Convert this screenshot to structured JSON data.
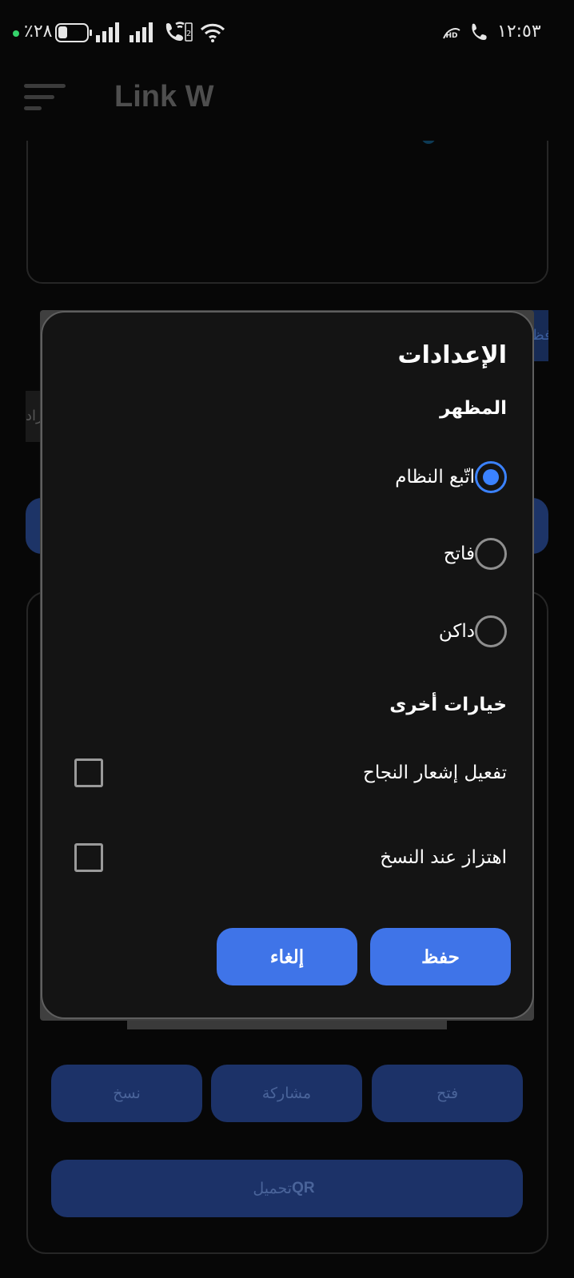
{
  "status_bar": {
    "battery_percent": "٪٢٨",
    "time": "١٢:٥٣",
    "icons": [
      "battery-icon",
      "signal-icon",
      "signal-icon",
      "wifi-calling-icon",
      "wifi-icon",
      "hd-voice-icon",
      "phone-icon"
    ]
  },
  "app_bar": {
    "title": "Link W",
    "menu_icon": "menu-icon"
  },
  "background": {
    "right_tab_fragment": "فظ",
    "left_tab_fragment": "راد",
    "buttons": {
      "open": "فتح",
      "share": "مشاركة",
      "copy": "نسخ",
      "download_qr_text": "تحميل",
      "download_qr_bold": "QR"
    }
  },
  "dialog": {
    "title": "الإعدادات",
    "appearance": {
      "heading": "المظهر",
      "options": [
        {
          "label": "اتّبع النظام",
          "checked": true
        },
        {
          "label": "فاتح",
          "checked": false
        },
        {
          "label": "داكن",
          "checked": false
        }
      ]
    },
    "other": {
      "heading": "خيارات أخرى",
      "options": [
        {
          "label": "تفعيل إشعار النجاح",
          "checked": false
        },
        {
          "label": "اهتزاز عند النسخ",
          "checked": false
        }
      ]
    },
    "buttons": {
      "save": "حفظ",
      "cancel": "إلغاء"
    }
  },
  "colors": {
    "accent": "#3b82ff",
    "button": "#3f74e8",
    "dialog_bg": "#141414"
  }
}
